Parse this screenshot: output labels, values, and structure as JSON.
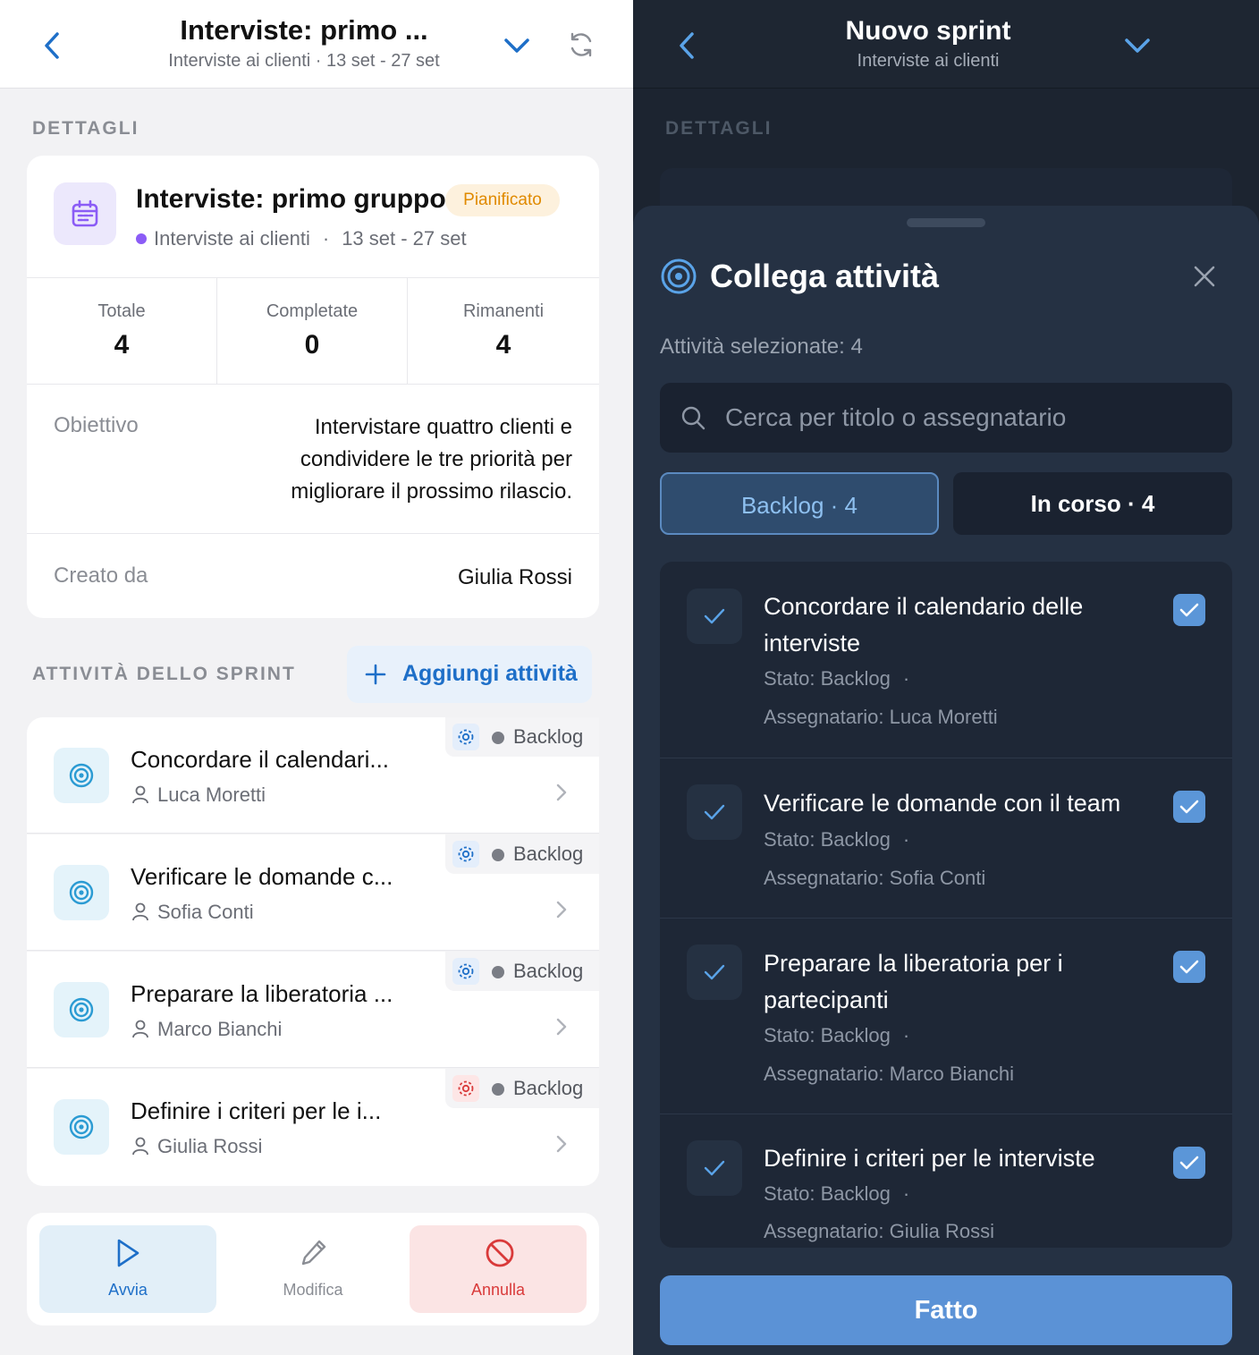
{
  "left": {
    "header": {
      "title": "Interviste: primo ...",
      "subtitle": "Interviste ai clienti · 13 set - 27 set"
    },
    "details_label": "DETTAGLI",
    "sprint": {
      "title": "Interviste: primo gruppo",
      "status": "Pianificato",
      "project": "Interviste ai clienti",
      "separator": "·",
      "dates": "13 set - 27 set"
    },
    "stats": [
      {
        "label": "Totale",
        "value": "4"
      },
      {
        "label": "Completate",
        "value": "0"
      },
      {
        "label": "Rimanenti",
        "value": "4"
      }
    ],
    "objective": {
      "label": "Obiettivo",
      "value": "Intervistare quattro clienti e condividere le tre priorità per migliorare il prossimo rilascio."
    },
    "creator": {
      "label": "Creato da",
      "value": "Giulia Rossi"
    },
    "tasks_label": "ATTIVITÀ DELLO SPRINT",
    "add_task": "Aggiungi attività",
    "tasks": [
      {
        "name": "Concordare il calendari...",
        "user": "Luca Moretti",
        "status": "Backlog"
      },
      {
        "name": "Verificare le domande c...",
        "user": "Sofia Conti",
        "status": "Backlog"
      },
      {
        "name": "Preparare la liberatoria ...",
        "user": "Marco Bianchi",
        "status": "Backlog"
      },
      {
        "name": "Definire i criteri per le i...",
        "user": "Giulia Rossi",
        "status": "Backlog"
      }
    ],
    "actions": {
      "start": "Avvia",
      "edit": "Modifica",
      "cancel": "Annulla"
    }
  },
  "right": {
    "header": {
      "title": "Nuovo sprint",
      "subtitle": "Interviste ai clienti"
    },
    "details_label": "DETTAGLI",
    "sheet": {
      "title": "Collega attività",
      "selected": "Attività selezionate: 4",
      "search_placeholder": "Cerca per titolo o assegnatario",
      "tabs": [
        "Backlog · 4",
        "In corso · 4"
      ],
      "items": [
        {
          "name": "Concordare il calendario delle interviste",
          "state": "Stato: Backlog",
          "dot": "·",
          "assignee": "Assegnatario: Luca Moretti"
        },
        {
          "name": "Verificare le domande con il team",
          "state": "Stato: Backlog",
          "dot": "·",
          "assignee": "Assegnatario: Sofia Conti"
        },
        {
          "name": "Preparare la liberatoria per i partecipanti",
          "state": "Stato: Backlog",
          "dot": "·",
          "assignee": "Assegnatario: Marco Bianchi"
        },
        {
          "name": "Definire i criteri per le interviste",
          "state": "Stato: Backlog",
          "dot": "·",
          "assignee": "Assegnatario: Giulia Rossi"
        }
      ],
      "done": "Fatto"
    }
  },
  "colors": {
    "accent": "#1e6fc8",
    "pending": "#e08a00",
    "danger": "#d93a3a",
    "dark_bg": "#1c2430"
  },
  "icons": [
    "back-chevron-icon",
    "chevron-down-icon",
    "refresh-icon",
    "calendar-icon",
    "target-icon",
    "user-icon",
    "gear-icon",
    "play-icon",
    "pencil-icon",
    "ban-icon",
    "close-icon",
    "search-icon",
    "checkmark-icon"
  ]
}
